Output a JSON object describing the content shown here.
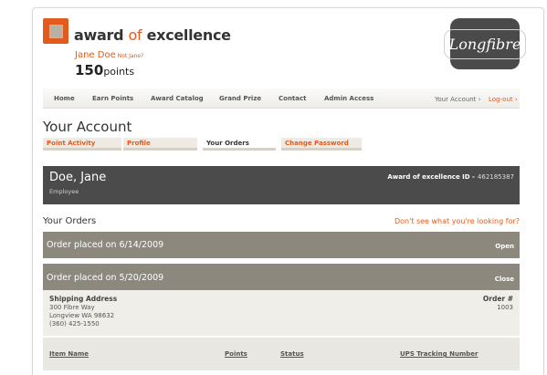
{
  "brand": {
    "award": "award",
    "of": "of",
    "excellence": "excellence",
    "partner_logo": "Longfibre"
  },
  "user": {
    "name": "Jane Doe",
    "not_me": "Not Jane?",
    "points_value": "150",
    "points_unit": "points"
  },
  "nav": {
    "items": [
      "Home",
      "Earn Points",
      "Award Catalog",
      "Grand Prize",
      "Contact",
      "Admin Access"
    ],
    "account_link": "Your Account ›",
    "logout_link": "Log-out ›"
  },
  "account": {
    "title": "Your Account",
    "tabs": [
      "Point Activity",
      "Profile",
      "Your Orders",
      "Change Password"
    ],
    "active_tab": "Your Orders"
  },
  "customer": {
    "name": "Doe, Jane",
    "role": "Employee",
    "award_label": "Award of excellence ID -",
    "award_id": "462185387"
  },
  "orders": {
    "title": "Your Orders",
    "help_link": "Don't see what you're looking for?",
    "list": [
      {
        "label": "Order placed on 6/14/2009",
        "action": "Open"
      },
      {
        "label": "Order placed on 5/20/2009",
        "action": "Close"
      }
    ],
    "details": {
      "shipping_label": "Shipping Address",
      "address_lines": [
        "300 Fibre Way",
        "Longview WA  98632",
        "(360) 425-1550"
      ],
      "order_label": "Order #",
      "order_number": "1003"
    },
    "columns": [
      "Item Name",
      "Points",
      "Status",
      "UPS Tracking Number"
    ]
  },
  "colors": {
    "accent": "#e25a1c",
    "dark_panel": "#4b4b4b",
    "order_bar": "#8c887e"
  },
  "icons": [
    "award-logo-icon"
  ]
}
